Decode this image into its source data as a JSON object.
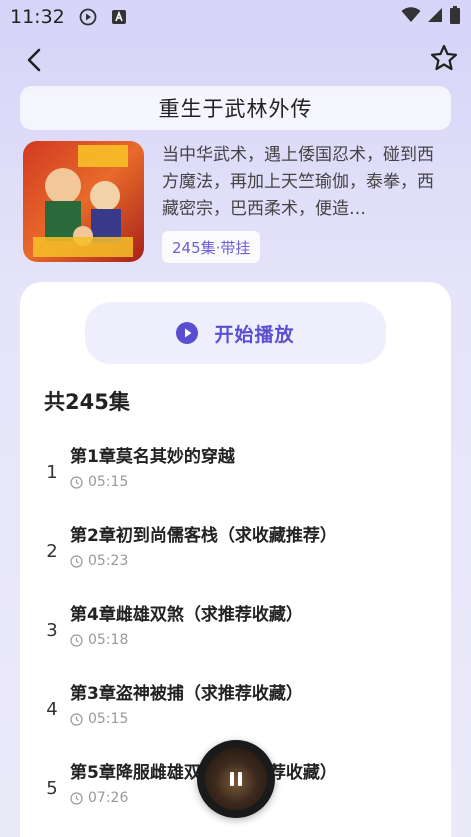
{
  "status_bar": {
    "time": "11:32",
    "icons": [
      "play-circle-icon",
      "a-square-icon",
      "wifi-icon",
      "signal-icon",
      "battery-icon"
    ]
  },
  "nav": {
    "back_icon": "chevron-left-icon",
    "favorite_icon": "star-outline-icon"
  },
  "book": {
    "title": "重生于武林外传",
    "description": "当中华武术，遇上倭国忍术，碰到西方魔法，再加上天竺瑜伽，泰拳，西藏密宗，巴西柔术，便造…",
    "tag": "245集·带挂",
    "cover_icon": "book-cover-image"
  },
  "player": {
    "play_label": "开始播放",
    "play_icon": "play-circle-icon",
    "episode_count": "共245集"
  },
  "episodes": [
    {
      "num": "1",
      "title": "第1章莫名其妙的穿越",
      "duration": "05:15"
    },
    {
      "num": "2",
      "title": "第2章初到尚儒客栈（求收藏推荐）",
      "duration": "05:23"
    },
    {
      "num": "3",
      "title": "第4章雌雄双煞（求推荐收藏）",
      "duration": "05:18"
    },
    {
      "num": "4",
      "title": "第3章盗神被捕（求推荐收藏）",
      "duration": "05:15"
    },
    {
      "num": "5",
      "title": "第5章降服雌雄双煞（求推荐收藏）",
      "duration": "07:26"
    }
  ],
  "colors": {
    "accent": "#5a4fcf",
    "background": "#dcdaf8",
    "card": "#ffffff"
  }
}
